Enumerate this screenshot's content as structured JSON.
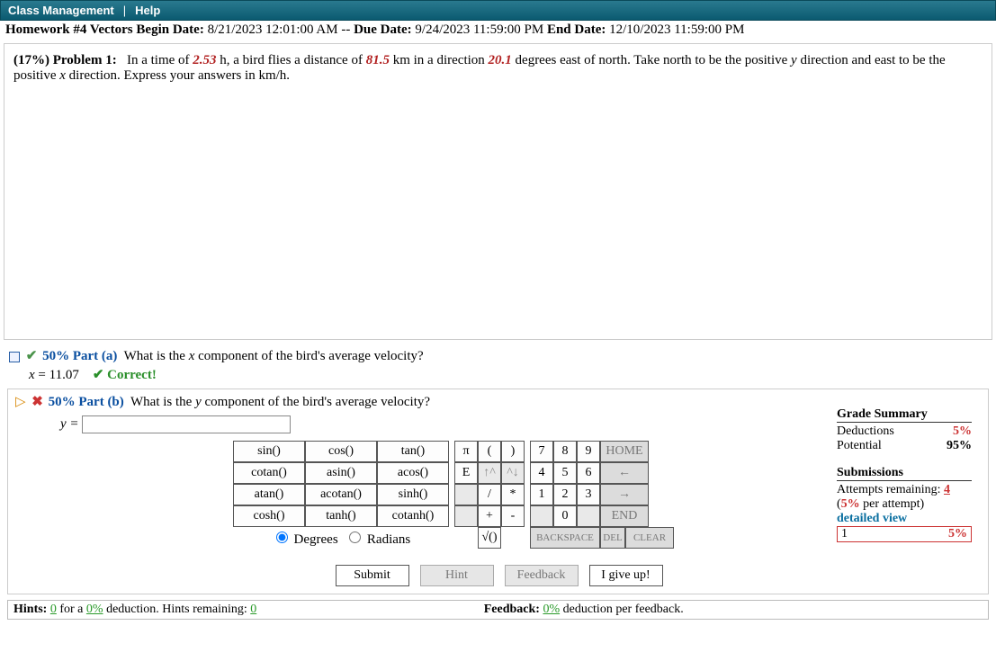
{
  "topbar": {
    "class_management": "Class Management",
    "help": "Help"
  },
  "hw": {
    "title": "Homework #4 Vectors",
    "begin_label": "Begin Date:",
    "begin_value": "8/21/2023 12:01:00 AM",
    "sep": "--",
    "due_label": "Due Date:",
    "due_value": "9/24/2023 11:59:00 PM",
    "end_label": "End Date:",
    "end_value": "12/10/2023 11:59:00 PM"
  },
  "problem": {
    "percent_label": "(17%)  Problem 1:",
    "text1": "In a time of ",
    "v1": "2.53",
    "text2": " h, a bird flies a distance of ",
    "v2": "81.5",
    "text3": " km in a direction ",
    "v3": "20.1",
    "text4": " degrees east of north. Take north to be the positive ",
    "yv": "y",
    "text5": " direction and east to be the positive ",
    "xv": "x",
    "text6": " direction. Express your answers in km/h."
  },
  "part_a": {
    "label": "50% Part (a)",
    "question": "What is the ",
    "var": "x",
    "question2": " component of the bird's average velocity?",
    "answer_var": "x",
    "answer_value": "= 11.07",
    "correct": "✔ Correct!"
  },
  "part_b": {
    "label": "50% Part (b)",
    "question": "What is the ",
    "var": "y",
    "question2": " component of the bird's average velocity?",
    "answer_var": "y =",
    "input_value": ""
  },
  "keypad": {
    "functions": [
      [
        "sin()",
        "cos()",
        "tan()"
      ],
      [
        "cotan()",
        "asin()",
        "acos()"
      ],
      [
        "atan()",
        "acotan()",
        "sinh()"
      ],
      [
        "cosh()",
        "tanh()",
        "cotanh()"
      ]
    ],
    "deg_label": "Degrees",
    "rad_label": "Radians",
    "ops": [
      [
        "π",
        "(",
        ")"
      ],
      [
        "E",
        "↑^",
        "^↓"
      ],
      [
        "",
        "/",
        "*"
      ],
      [
        "",
        "+",
        "-"
      ],
      [
        "",
        "√()",
        ""
      ]
    ],
    "nums": [
      [
        "7",
        "8",
        "9",
        "HOME"
      ],
      [
        "4",
        "5",
        "6",
        "←"
      ],
      [
        "1",
        "2",
        "3",
        "→"
      ],
      [
        "",
        "0",
        "",
        "END"
      ],
      [
        "BACKSPACE",
        "DEL",
        "CLEAR"
      ]
    ]
  },
  "buttons": {
    "submit": "Submit",
    "hint": "Hint",
    "feedback": "Feedback",
    "giveup": "I give up!"
  },
  "summary": {
    "title": "Grade Summary",
    "deductions_label": "Deductions",
    "deductions_value": "5%",
    "potential_label": "Potential",
    "potential_value": "95%",
    "sub_title": "Submissions",
    "attempts_label": "Attempts remaining: ",
    "attempts_value": "4",
    "per_attempt": "(5% per attempt)",
    "detailed": "detailed view",
    "row1_num": "1",
    "row1_val": "5%"
  },
  "hints": {
    "left1": "Hints: ",
    "left_hcount": "0",
    "left2": " for a ",
    "left_pct": "0%",
    "left3": " deduction. Hints remaining: ",
    "left_remain": "0",
    "right1": "Feedback: ",
    "right_pct": "0%",
    "right2": " deduction per feedback."
  }
}
